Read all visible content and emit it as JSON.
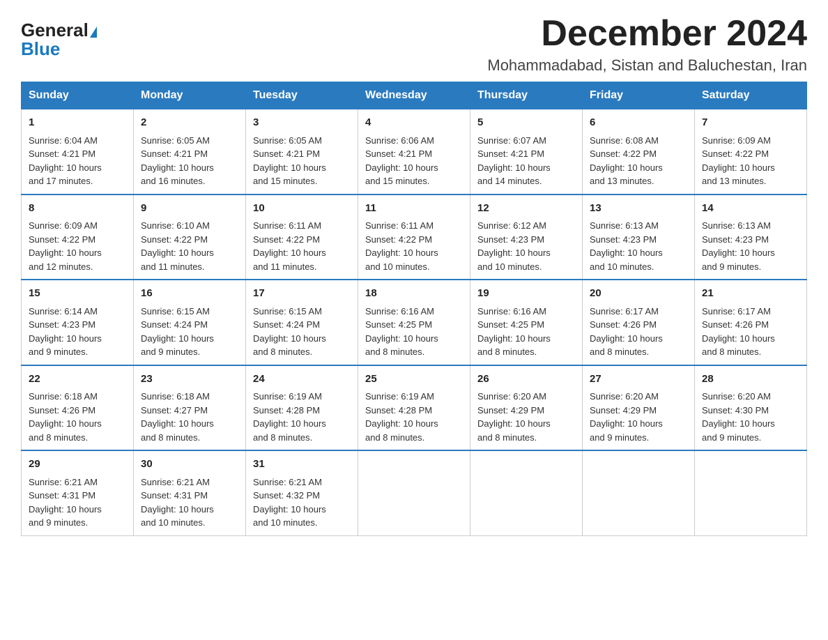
{
  "header": {
    "logo_general": "General",
    "logo_blue": "Blue",
    "title": "December 2024",
    "subtitle": "Mohammadabad, Sistan and Baluchestan, Iran"
  },
  "days_of_week": [
    "Sunday",
    "Monday",
    "Tuesday",
    "Wednesday",
    "Thursday",
    "Friday",
    "Saturday"
  ],
  "weeks": [
    [
      {
        "day": "1",
        "sunrise": "6:04 AM",
        "sunset": "4:21 PM",
        "daylight": "10 hours and 17 minutes."
      },
      {
        "day": "2",
        "sunrise": "6:05 AM",
        "sunset": "4:21 PM",
        "daylight": "10 hours and 16 minutes."
      },
      {
        "day": "3",
        "sunrise": "6:05 AM",
        "sunset": "4:21 PM",
        "daylight": "10 hours and 15 minutes."
      },
      {
        "day": "4",
        "sunrise": "6:06 AM",
        "sunset": "4:21 PM",
        "daylight": "10 hours and 15 minutes."
      },
      {
        "day": "5",
        "sunrise": "6:07 AM",
        "sunset": "4:21 PM",
        "daylight": "10 hours and 14 minutes."
      },
      {
        "day": "6",
        "sunrise": "6:08 AM",
        "sunset": "4:22 PM",
        "daylight": "10 hours and 13 minutes."
      },
      {
        "day": "7",
        "sunrise": "6:09 AM",
        "sunset": "4:22 PM",
        "daylight": "10 hours and 13 minutes."
      }
    ],
    [
      {
        "day": "8",
        "sunrise": "6:09 AM",
        "sunset": "4:22 PM",
        "daylight": "10 hours and 12 minutes."
      },
      {
        "day": "9",
        "sunrise": "6:10 AM",
        "sunset": "4:22 PM",
        "daylight": "10 hours and 11 minutes."
      },
      {
        "day": "10",
        "sunrise": "6:11 AM",
        "sunset": "4:22 PM",
        "daylight": "10 hours and 11 minutes."
      },
      {
        "day": "11",
        "sunrise": "6:11 AM",
        "sunset": "4:22 PM",
        "daylight": "10 hours and 10 minutes."
      },
      {
        "day": "12",
        "sunrise": "6:12 AM",
        "sunset": "4:23 PM",
        "daylight": "10 hours and 10 minutes."
      },
      {
        "day": "13",
        "sunrise": "6:13 AM",
        "sunset": "4:23 PM",
        "daylight": "10 hours and 10 minutes."
      },
      {
        "day": "14",
        "sunrise": "6:13 AM",
        "sunset": "4:23 PM",
        "daylight": "10 hours and 9 minutes."
      }
    ],
    [
      {
        "day": "15",
        "sunrise": "6:14 AM",
        "sunset": "4:23 PM",
        "daylight": "10 hours and 9 minutes."
      },
      {
        "day": "16",
        "sunrise": "6:15 AM",
        "sunset": "4:24 PM",
        "daylight": "10 hours and 9 minutes."
      },
      {
        "day": "17",
        "sunrise": "6:15 AM",
        "sunset": "4:24 PM",
        "daylight": "10 hours and 8 minutes."
      },
      {
        "day": "18",
        "sunrise": "6:16 AM",
        "sunset": "4:25 PM",
        "daylight": "10 hours and 8 minutes."
      },
      {
        "day": "19",
        "sunrise": "6:16 AM",
        "sunset": "4:25 PM",
        "daylight": "10 hours and 8 minutes."
      },
      {
        "day": "20",
        "sunrise": "6:17 AM",
        "sunset": "4:26 PM",
        "daylight": "10 hours and 8 minutes."
      },
      {
        "day": "21",
        "sunrise": "6:17 AM",
        "sunset": "4:26 PM",
        "daylight": "10 hours and 8 minutes."
      }
    ],
    [
      {
        "day": "22",
        "sunrise": "6:18 AM",
        "sunset": "4:26 PM",
        "daylight": "10 hours and 8 minutes."
      },
      {
        "day": "23",
        "sunrise": "6:18 AM",
        "sunset": "4:27 PM",
        "daylight": "10 hours and 8 minutes."
      },
      {
        "day": "24",
        "sunrise": "6:19 AM",
        "sunset": "4:28 PM",
        "daylight": "10 hours and 8 minutes."
      },
      {
        "day": "25",
        "sunrise": "6:19 AM",
        "sunset": "4:28 PM",
        "daylight": "10 hours and 8 minutes."
      },
      {
        "day": "26",
        "sunrise": "6:20 AM",
        "sunset": "4:29 PM",
        "daylight": "10 hours and 8 minutes."
      },
      {
        "day": "27",
        "sunrise": "6:20 AM",
        "sunset": "4:29 PM",
        "daylight": "10 hours and 9 minutes."
      },
      {
        "day": "28",
        "sunrise": "6:20 AM",
        "sunset": "4:30 PM",
        "daylight": "10 hours and 9 minutes."
      }
    ],
    [
      {
        "day": "29",
        "sunrise": "6:21 AM",
        "sunset": "4:31 PM",
        "daylight": "10 hours and 9 minutes."
      },
      {
        "day": "30",
        "sunrise": "6:21 AM",
        "sunset": "4:31 PM",
        "daylight": "10 hours and 10 minutes."
      },
      {
        "day": "31",
        "sunrise": "6:21 AM",
        "sunset": "4:32 PM",
        "daylight": "10 hours and 10 minutes."
      },
      null,
      null,
      null,
      null
    ]
  ],
  "labels": {
    "sunrise": "Sunrise:",
    "sunset": "Sunset:",
    "daylight": "Daylight:"
  }
}
